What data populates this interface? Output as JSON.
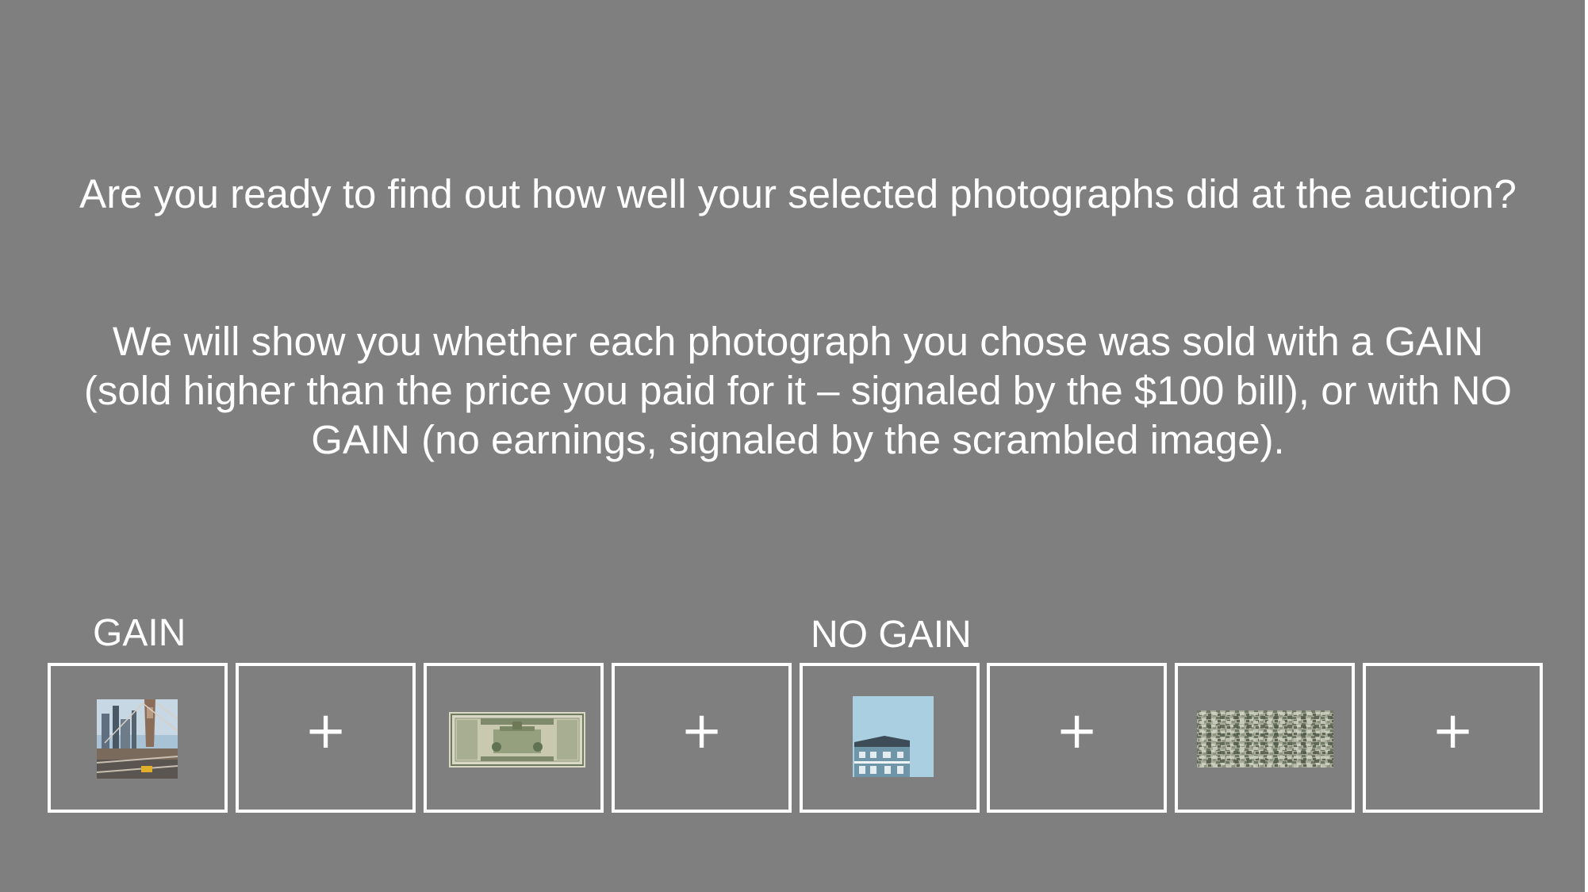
{
  "question_1": "Are you ready to find out how well your selected photographs did at the auction?",
  "question_2": "We will show you whether each photograph you chose was sold with a GAIN (sold higher than the price you paid for it – signaled by the $100 bill), or with NO GAIN (no earnings, signaled by the scrambled image).",
  "labels": {
    "gain": "GAIN",
    "no_gain": "NO GAIN"
  },
  "sequence": [
    {
      "type": "photo",
      "icon": "city-bridge-photo"
    },
    {
      "type": "fixation",
      "glyph": "+"
    },
    {
      "type": "outcome",
      "icon": "hundred-dollar-bill"
    },
    {
      "type": "fixation",
      "glyph": "+"
    },
    {
      "type": "photo",
      "icon": "house-photo"
    },
    {
      "type": "fixation",
      "glyph": "+"
    },
    {
      "type": "outcome",
      "icon": "scrambled-image"
    },
    {
      "type": "fixation",
      "glyph": "+"
    }
  ],
  "colors": {
    "background": "#7f7f7f",
    "text": "#ffffff",
    "frame": "#ffffff"
  }
}
